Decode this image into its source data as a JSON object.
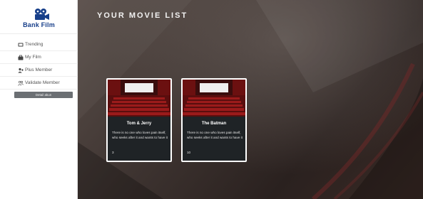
{
  "sidebar": {
    "brand": {
      "text": "Bank Film",
      "logo_icon": "film-camera-icon",
      "color": "#173f8a"
    },
    "items": [
      {
        "label": "Trending",
        "icon": "tv-icon"
      },
      {
        "label": "My Film",
        "icon": "briefcase-icon"
      },
      {
        "label": "Plus Member",
        "icon": "add-user-icon"
      },
      {
        "label": "Validate Member",
        "icon": "users-icon"
      }
    ],
    "detail_button": "Detail akun"
  },
  "main": {
    "title": "YOUR MOVIE LIST",
    "cards": [
      {
        "title": "Tom & Jerry",
        "description": "There is no one who loves pain itself, who seeks after it and wants to have it",
        "number": "3",
        "image_icon": "cinema-hall-image"
      },
      {
        "title": "The Batman",
        "description": "There is no one who loves pain itself, who seeks after it and wants to have it",
        "number": "10",
        "image_icon": "cinema-hall-image"
      }
    ]
  }
}
